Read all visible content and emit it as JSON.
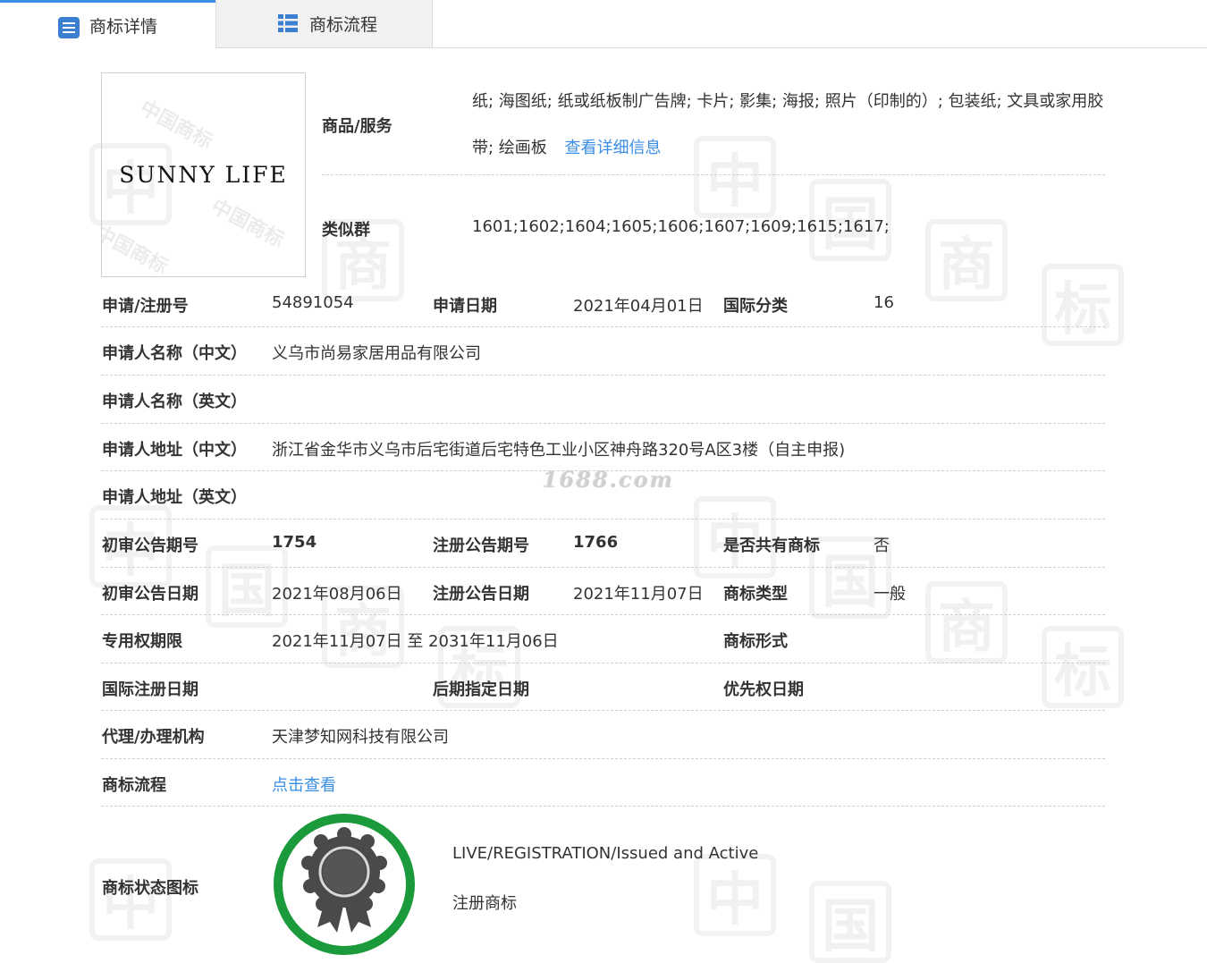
{
  "tabs": [
    {
      "label": "商标详情",
      "icon": "list-doc-icon",
      "active": true
    },
    {
      "label": "商标流程",
      "icon": "table-list-icon",
      "active": false
    }
  ],
  "watermark": {
    "site": "1688.com",
    "stamp_chars": [
      "中",
      "国",
      "商",
      "标"
    ]
  },
  "logo": {
    "text": "SUNNY LIFE",
    "watermark_text": "中国商标"
  },
  "goods": {
    "label": "商品/服务",
    "text": "纸; 海图纸; 纸或纸板制广告牌; 卡片; 影集; 海报; 照片（印制的）; 包装纸; 文具或家用胶带; 绘画板",
    "link": "查看详细信息"
  },
  "similar_group": {
    "label": "类似群",
    "value": "1601;1602;1604;1605;1606;1607;1609;1615;1617;"
  },
  "rows": {
    "reg_no_label": "申请/注册号",
    "reg_no": "54891054",
    "apply_date_label": "申请日期",
    "apply_date": "2021年04月01日",
    "intl_class_label": "国际分类",
    "intl_class": "16",
    "applicant_cn_label": "申请人名称（中文）",
    "applicant_cn": "义乌市尚易家居用品有限公司",
    "applicant_en_label": "申请人名称（英文）",
    "applicant_en": "",
    "address_cn_label": "申请人地址（中文）",
    "address_cn": "浙江省金华市义乌市后宅街道后宅特色工业小区神舟路320号A区3楼（自主申报)",
    "address_en_label": "申请人地址（英文）",
    "address_en": "",
    "prelim_no_label": "初审公告期号",
    "prelim_no": "1754",
    "reg_pub_no_label": "注册公告期号",
    "reg_pub_no": "1766",
    "shared_label": "是否共有商标",
    "shared": "否",
    "prelim_date_label": "初审公告日期",
    "prelim_date": "2021年08月06日",
    "reg_pub_date_label": "注册公告日期",
    "reg_pub_date": "2021年11月07日",
    "tm_type_label": "商标类型",
    "tm_type": "一般",
    "exclusive_label": "专用权期限",
    "exclusive": "2021年11月07日 至 2031年11月06日",
    "tm_form_label": "商标形式",
    "tm_form": "",
    "intl_reg_date_label": "国际注册日期",
    "intl_reg_date": "",
    "later_date_label": "后期指定日期",
    "later_date": "",
    "priority_label": "优先权日期",
    "priority": "",
    "agent_label": "代理/办理机构",
    "agent": "天津梦知网科技有限公司",
    "flow_label": "商标流程",
    "flow_link": "点击查看",
    "status_icon_label": "商标状态图标"
  },
  "status": {
    "english": "LIVE/REGISTRATION/Issued and Active",
    "chinese": "注册商标",
    "badge_ring_color": "#1a9a3a",
    "badge_color": "#4a4a4a"
  }
}
